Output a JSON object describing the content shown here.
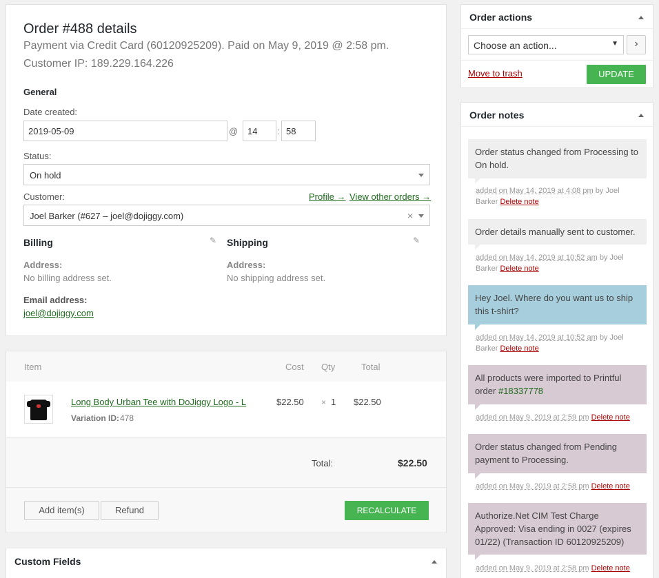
{
  "order": {
    "title": "Order #488 details",
    "payment_line": "Payment via Credit Card (60120925209). Paid on May 9, 2019 @ 2:58 pm.",
    "ip_line": "Customer IP: 189.229.164.226",
    "general_heading": "General",
    "date_label": "Date created:",
    "date_value": "2019-05-09",
    "at": "@",
    "hour": "14",
    "colon": ":",
    "minute": "58",
    "status_label": "Status:",
    "status_value": "On hold",
    "customer_label": "Customer:",
    "profile_link": "Profile →",
    "view_orders_link": "View other orders →",
    "customer_value": "Joel Barker (#627 – joel@dojiggy.com)",
    "clear": "×",
    "billing_heading": "Billing",
    "billing_address_label": "Address:",
    "billing_address_value": "No billing address set.",
    "email_label": "Email address:",
    "email_value": "joel@dojiggy.com",
    "shipping_heading": "Shipping",
    "shipping_address_label": "Address:",
    "shipping_address_value": "No shipping address set."
  },
  "items": {
    "headers": {
      "item": "Item",
      "cost": "Cost",
      "qty": "Qty",
      "total": "Total"
    },
    "rows": [
      {
        "name": "Long Body Urban Tee with DoJiggy Logo - L",
        "variation": "Variation ID:",
        "variation_id": "478",
        "cost": "$22.50",
        "times": "×",
        "qty": "1",
        "total": "$22.50"
      }
    ],
    "total_label": "Total:",
    "total_value": "$22.50",
    "add_items": "Add item(s)",
    "refund": "Refund",
    "recalculate": "RECALCULATE"
  },
  "custom_fields": {
    "title": "Custom Fields"
  },
  "actions": {
    "title": "Order actions",
    "select_value": "Choose an action...",
    "go": "›",
    "trash": "Move to trash",
    "update": "UPDATE"
  },
  "notes": {
    "title": "Order notes",
    "items": [
      {
        "text": "Order status changed from Processing to On hold.",
        "date": "added on May 14, 2019 at 4:08 pm",
        "by": "by Joel Barker",
        "delete": "Delete note"
      },
      {
        "text": "Order details manually sent to customer.",
        "date": "added on May 14, 2019 at 10:52 am",
        "by": "by Joel Barker",
        "delete": "Delete note"
      },
      {
        "text": "Hey Joel. Where do you want us to ship this t-shirt?",
        "date": "added on May 14, 2019 at 10:52 am",
        "by": "by Joel Barker",
        "delete": "Delete note"
      },
      {
        "text_pre": "All products were imported to Printful order ",
        "link": "#18337778",
        "date": "added on May 9, 2019 at 2:59 pm",
        "delete": "Delete note"
      },
      {
        "text": "Order status changed from Pending payment to Processing.",
        "date": "added on May 9, 2019 at 2:58 pm",
        "delete": "Delete note"
      },
      {
        "text": "Authorize.Net CIM Test Charge Approved: Visa ending in 0027 (expires 01/22) (Transaction ID 60120925209)",
        "date": "added on May 9, 2019 at 2:58 pm",
        "delete": "Delete note"
      }
    ]
  },
  "colors": {
    "accent_green": "#46b450",
    "link_green": "#1e6b1e",
    "note_blue": "#a7cedc",
    "note_purple": "#d7cad2",
    "note_gray": "#efefef",
    "delete_red": "#a00"
  }
}
